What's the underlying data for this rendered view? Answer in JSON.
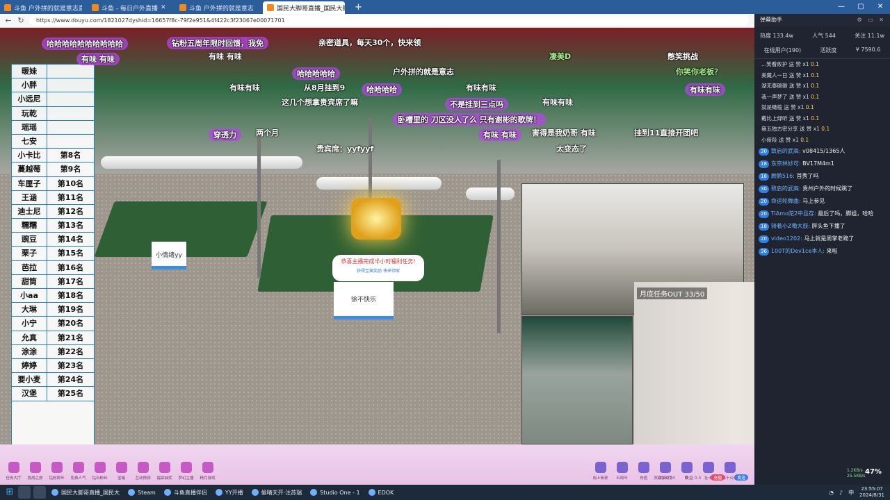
{
  "browser": {
    "tabs": [
      {
        "label": "斗鱼 户外拼的就是意志直播间",
        "active": false
      },
      {
        "label": "斗鱼 - 每日户外直播",
        "active": false
      },
      {
        "label": "斗鱼 户外拼的就是意志",
        "active": false
      },
      {
        "label": "国民大脚哥直播_国民大脚哥",
        "active": true
      }
    ],
    "url": "https://www.douyu.com/1821027dyshid=16657f8c-79f2e951&4f422c3f23067e00071701",
    "window_controls": {
      "minimize": "—",
      "maximize": "▢",
      "close": "✕"
    }
  },
  "stream": {
    "rank_list": [
      {
        "name": "暖妹",
        "place": ""
      },
      {
        "name": "小胖",
        "place": ""
      },
      {
        "name": "小远尼",
        "place": ""
      },
      {
        "name": "玩乾",
        "place": ""
      },
      {
        "name": "瑶瑶",
        "place": ""
      },
      {
        "name": "七安",
        "place": ""
      },
      {
        "name": "小卡比",
        "place": "第8名"
      },
      {
        "name": "蔓越莓",
        "place": "第9名"
      },
      {
        "name": "车厘子",
        "place": "第10名"
      },
      {
        "name": "王涵",
        "place": "第11名"
      },
      {
        "name": "迪士尼",
        "place": "第12名"
      },
      {
        "name": "糯糯",
        "place": "第13名"
      },
      {
        "name": "豌豆",
        "place": "第14名"
      },
      {
        "name": "栗子",
        "place": "第15名"
      },
      {
        "name": "芭拉",
        "place": "第16名"
      },
      {
        "name": "甜筒",
        "place": "第17名"
      },
      {
        "name": "小aa",
        "place": "第18名"
      },
      {
        "name": "大琳",
        "place": "第19名"
      },
      {
        "name": "小宁",
        "place": "第20名"
      },
      {
        "name": "允真",
        "place": "第21名"
      },
      {
        "name": "涂涂",
        "place": "第22名"
      },
      {
        "name": "婷婷",
        "place": "第23名"
      },
      {
        "name": "要小麦",
        "place": "第24名"
      },
      {
        "name": "汉堡",
        "place": "第25名"
      }
    ],
    "danmaku": [
      "哈哈哈哈哈哈哈哈哈哈",
      "钻粉五周年限时回馈，我免",
      "亲密道具，每天30个，快来领",
      "有味 有味",
      "有味 有味",
      "凄美D",
      "憋笑挑战",
      "户外拼的就是意志",
      "哈哈哈哈哈",
      "你笑你老板？",
      "有味有味",
      "从8月挂到9",
      "哈哈哈哈",
      "有味有味",
      "有味有味",
      "这几个想拿贵宾席了嘛",
      "不是挂到三点吗",
      "有味有味",
      "卧槽里的 刀区没人了么 只有谢彬的歌牌！",
      "有味 有味",
      "害得是我奶哥 有味",
      "挂到11直接开团吧",
      "贵宾席：yyfyyf",
      "太变态了",
      "两个月",
      "穿透力"
    ],
    "chest_tip": {
      "line1": "恭喜主播完成半小时福利任务!",
      "line2": "获得宝箱奖励 快来领取"
    },
    "sign_left": "小情绪yy",
    "sign_right": "徐不快乐",
    "cam_label": "月底任务OUT  33/50"
  },
  "chat": {
    "title": "弹幕助手",
    "stats": {
      "hot": "热度 133.4w",
      "popularity": "人气 544",
      "follow": "关注 11.1w"
    },
    "tabs": [
      "在线用户(190)",
      "活跃度",
      "¥ 7590.6"
    ],
    "gifts": [
      {
        "user": "...笑看败护",
        "text": "送 赞 x1",
        "amt": "0.1"
      },
      {
        "user": "美藏人一日",
        "text": "送 赞 x1",
        "amt": "0.1"
      },
      {
        "user": "湖无泰碳碳",
        "text": "送 赞 x1",
        "amt": "0.1"
      },
      {
        "user": "我一声梦了",
        "text": "送 赞 x1",
        "amt": "0.1"
      },
      {
        "user": "就是橄榄",
        "text": "送 赞 x1",
        "amt": "0.1"
      },
      {
        "user": "戴比上绿听",
        "text": "送 赞 x1",
        "amt": "0.1"
      },
      {
        "user": "雍五独古密分享",
        "text": "送 赞 x1",
        "amt": "0.1"
      },
      {
        "user": "小俯段",
        "text": "送 赞 x1",
        "amt": "0.1"
      }
    ],
    "messages": [
      {
        "level": "30",
        "user": "致启的武高:",
        "text": "v08415/1365人"
      },
      {
        "level": "18",
        "user": "东京林妙可:",
        "text": "BV17M4m1"
      },
      {
        "level": "18",
        "user": "蕨鹏516:",
        "text": "首秀了吗"
      },
      {
        "level": "30",
        "user": "致启的武高:",
        "text": "贵州户外的时候跳了"
      },
      {
        "level": "20",
        "user": "命运轮舞曲:",
        "text": "马上参见"
      },
      {
        "level": "20",
        "user": "TiAmo陀2中且存:",
        "text": "最后了吗，脚姐，哈哈"
      },
      {
        "level": "18",
        "user": "骑着小Z嘞大鼓:",
        "text": "胖头鱼下播了"
      },
      {
        "level": "20",
        "user": "video1202:",
        "text": "马上就是周掌老跪了"
      },
      {
        "level": "36",
        "user": "100T的Dev1ce本人:",
        "text": "来啦"
      }
    ]
  },
  "bottom_bar": {
    "left_items": [
      "任务大厅",
      "挑战之旅",
      "钻粉周年",
      "免费人气",
      "钻石粉丝",
      "宝箱",
      "互动预测",
      "福袋抽奖",
      "梦幻主播",
      "精月游戏"
    ],
    "right_items": [
      "用上斩获",
      "五周年",
      "充值",
      "最强战力",
      "吹",
      "壮士",
      "暮十公布"
    ],
    "info": {
      "rank": "贡 313724",
      "income": "收益 0.4",
      "button": "充值",
      "action": "发送"
    }
  },
  "taskbar": {
    "apps": [
      "国民大脚哥直播_国民大",
      "Steam",
      "斗鱼直播伴侣",
      "YY开播",
      "偷晴天开·注苏瑞",
      "Studio One - 1",
      "EDOK"
    ],
    "time": "23:55:07",
    "date": "2024/8/31",
    "lang": "中"
  },
  "overlay": {
    "cpu": "47%",
    "net_up": "1.2KB/s",
    "net_down": "25.5KB/s"
  }
}
